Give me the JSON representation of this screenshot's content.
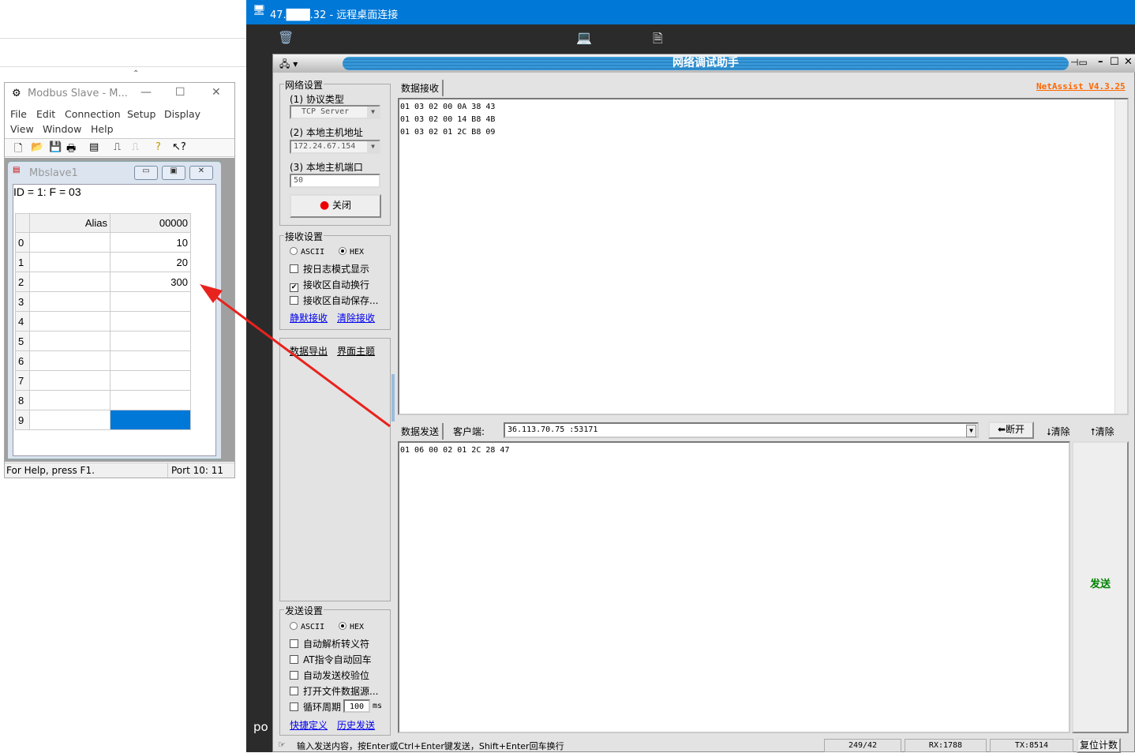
{
  "modbus": {
    "title": "Modbus Slave - M...",
    "menu": [
      "File",
      "Edit",
      "Connection",
      "Setup",
      "Display",
      "View",
      "Window",
      "Help"
    ],
    "child_title": "Mbslave1",
    "id_line": "ID = 1: F = 03",
    "header_alias": "Alias",
    "header_addr": "00000",
    "rows": [
      {
        "n": "0",
        "value": "10"
      },
      {
        "n": "1",
        "value": "20"
      },
      {
        "n": "2",
        "value": "300"
      },
      {
        "n": "3",
        "value": ""
      },
      {
        "n": "4",
        "value": ""
      },
      {
        "n": "5",
        "value": ""
      },
      {
        "n": "6",
        "value": ""
      },
      {
        "n": "7",
        "value": ""
      },
      {
        "n": "8",
        "value": ""
      },
      {
        "n": "9",
        "value": ""
      }
    ],
    "status_help": "For Help, press F1.",
    "status_port": "Port 10: 11"
  },
  "rdp": {
    "title": "47.███.32 - 远程桌面连接",
    "desktop_text": "po"
  },
  "netassist": {
    "title": "网络调试助手",
    "version": "NetAssist V4.3.25",
    "net": {
      "group": "网络设置",
      "proto_label": "(1) 协议类型",
      "proto_value": "TCP Server",
      "host_label": "(2) 本地主机地址",
      "host_value": "172.24.67.154",
      "port_label": "(3) 本地主机端口",
      "port_value": "50",
      "close_button": "关闭"
    },
    "recv": {
      "group": "接收设置",
      "ascii": "ASCII",
      "hex": "HEX",
      "options": [
        {
          "label": "按日志模式显示",
          "checked": false
        },
        {
          "label": "接收区自动换行",
          "checked": true
        },
        {
          "label": "接收区自动保存...",
          "checked": false
        }
      ],
      "silent": "静默接收",
      "clear": "清除接收"
    },
    "misc": {
      "export": "数据导出",
      "theme": "界面主题"
    },
    "send_settings": {
      "group": "发送设置",
      "ascii": "ASCII",
      "hex": "HEX",
      "options": [
        {
          "label": "自动解析转义符",
          "checked": false
        },
        {
          "label": "AT指令自动回车",
          "checked": false
        },
        {
          "label": "自动发送校验位",
          "checked": false
        },
        {
          "label": "打开文件数据源...",
          "checked": false
        }
      ],
      "loop_label": "循环周期",
      "loop_value": "100",
      "loop_unit": "ms",
      "shortcut": "快捷定义",
      "history": "历史发送"
    },
    "receive_tab": "数据接收",
    "receive_lines": [
      "01 03 02 00 0A 38 43",
      "01 03 02 00 14 B8 4B",
      "01 03 02 01 2C B8 09"
    ],
    "send_tab": "数据发送",
    "client_label": "客户端:",
    "client_value": "36.113.70.75 :53171",
    "disconnect": "断开",
    "clear1": "清除",
    "clear2": "清除",
    "send_text": "01 06 00 02 01 2C 28 47",
    "send_button": "发送",
    "status_hint": "输入发送内容，按Enter或Ctrl+Enter键发送，Shift+Enter回车换行",
    "status_count": "249/42",
    "status_rx": "RX:1788",
    "status_tx": "TX:8514",
    "reset_button": "复位计数"
  },
  "colors": {
    "rdp_blue": "#0078d7",
    "version_orange": "#ff6600",
    "send_green": "#008000",
    "arrow_red": "#e8231d",
    "selected_cell": "#0078d7"
  }
}
